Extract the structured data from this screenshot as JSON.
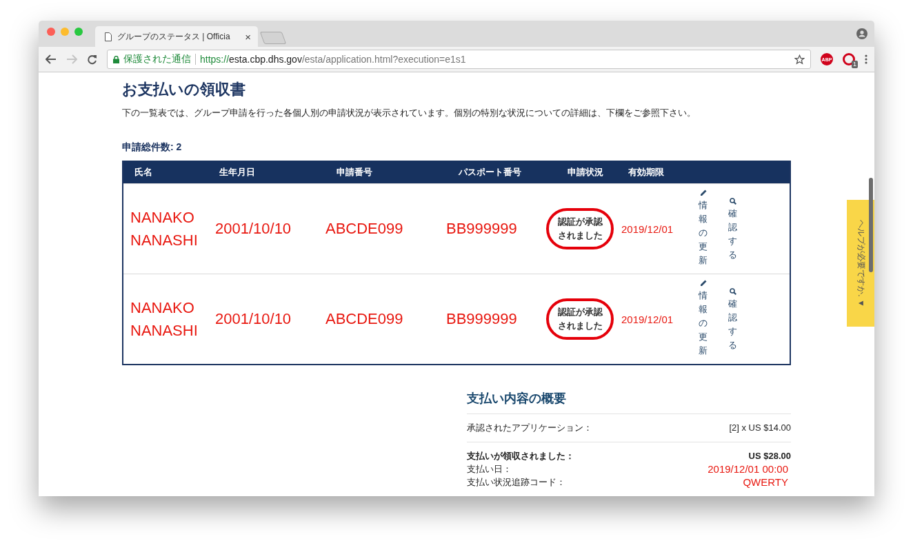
{
  "browser": {
    "tab_title": "グループのステータス | Officia",
    "tab_close": "×",
    "secure_label": "保護された通信",
    "url_scheme": "https://",
    "url_host": "esta.cbp.dhs.gov",
    "url_path": "/esta/application.html?execution=e1s1",
    "abp_label": "ABP",
    "extension_badge": "1"
  },
  "page": {
    "title": "お支払いの領収書",
    "description": "下の一覧表では、グループ申請を行った各個人別の申請状況が表示されています。個別の特別な状況についての詳細は、下欄をご参照下さい。",
    "total": "申請総件数: 2"
  },
  "table": {
    "columns": [
      "氏名",
      "生年月日",
      "申請番号",
      "パスポート番号",
      "申請状況",
      "有効期限"
    ],
    "rows": [
      {
        "name": "NANAKO NANASHI",
        "birth_date": "2001/10/10",
        "application_no": "ABCDE099",
        "passport_no": "BB999999",
        "status": "認証が承認されました",
        "status_circled": true,
        "expiry": "2019/12/01",
        "actions": [
          {
            "kind": "edit",
            "label": "情報の更新"
          },
          {
            "kind": "view",
            "label": "確認する"
          }
        ]
      },
      {
        "name": "NANAKO NANASHI",
        "birth_date": "2001/10/10",
        "application_no": "ABCDE099",
        "passport_no": "BB999999",
        "status": "認証が承認されました",
        "status_circled": true,
        "expiry": "2019/12/01",
        "actions": [
          {
            "kind": "edit",
            "label": "情報の更新"
          },
          {
            "kind": "view",
            "label": "確認する"
          }
        ]
      }
    ]
  },
  "summary": {
    "title": "支払い内容の概要",
    "lines": [
      {
        "kind": "normal",
        "label": "承認されたアプリケーション：",
        "value": "[2] x US $14.00"
      },
      {
        "kind": "bold",
        "label": "支払いが領収されました：",
        "value": "US $28.00"
      },
      {
        "kind": "annotated",
        "label": "支払い日：",
        "value": "2019/12/01 00:00"
      },
      {
        "kind": "annotated",
        "label": "支払い状況追跡コード：",
        "value": "QWERTY"
      }
    ]
  },
  "help_tab": {
    "label": "ヘルプが必要ですか.",
    "arrow": "▼"
  }
}
